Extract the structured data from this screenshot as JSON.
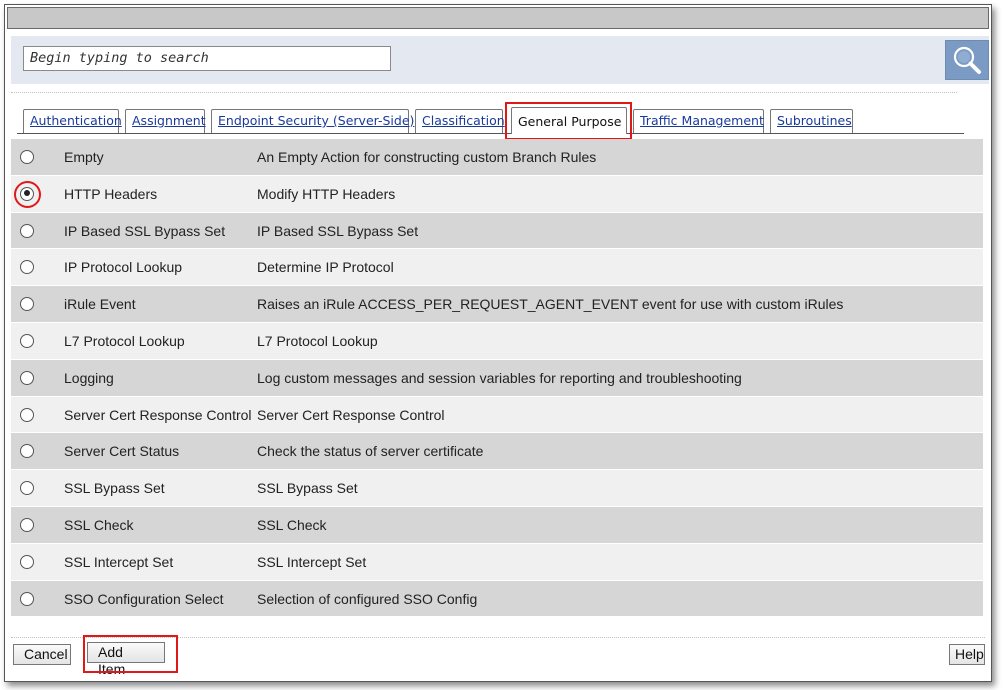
{
  "search": {
    "placeholder": "Begin typing to search"
  },
  "tabs": [
    {
      "label": "Authentication",
      "active": false
    },
    {
      "label": "Assignment",
      "active": false
    },
    {
      "label": "Endpoint Security (Server-Side)",
      "active": false
    },
    {
      "label": "Classification",
      "active": false
    },
    {
      "label": "General Purpose",
      "active": true
    },
    {
      "label": "Traffic Management",
      "active": false
    },
    {
      "label": "Subroutines",
      "active": false
    }
  ],
  "rows": [
    {
      "name": "Empty",
      "desc": "An Empty Action for constructing custom Branch Rules",
      "selected": false
    },
    {
      "name": "HTTP Headers",
      "desc": "Modify HTTP Headers",
      "selected": true
    },
    {
      "name": "IP Based SSL Bypass Set",
      "desc": "IP Based SSL Bypass Set",
      "selected": false
    },
    {
      "name": "IP Protocol Lookup",
      "desc": "Determine IP Protocol",
      "selected": false
    },
    {
      "name": "iRule Event",
      "desc": "Raises an iRule ACCESS_PER_REQUEST_AGENT_EVENT event for use with custom iRules",
      "selected": false
    },
    {
      "name": "L7 Protocol Lookup",
      "desc": "L7 Protocol Lookup",
      "selected": false
    },
    {
      "name": "Logging",
      "desc": "Log custom messages and session variables for reporting and troubleshooting",
      "selected": false
    },
    {
      "name": "Server Cert Response Control",
      "desc": "Server Cert Response Control",
      "selected": false
    },
    {
      "name": "Server Cert Status",
      "desc": "Check the status of server certificate",
      "selected": false
    },
    {
      "name": "SSL Bypass Set",
      "desc": "SSL Bypass Set",
      "selected": false
    },
    {
      "name": "SSL Check",
      "desc": "SSL Check",
      "selected": false
    },
    {
      "name": "SSL Intercept Set",
      "desc": "SSL Intercept Set",
      "selected": false
    },
    {
      "name": "SSO Configuration Select",
      "desc": "Selection of configured SSO Config",
      "selected": false
    }
  ],
  "footer": {
    "cancel_label": "Cancel",
    "add_label": "Add Item",
    "help_label": "Help"
  },
  "colors": {
    "highlight": "#e01818",
    "search_button": "#7b9bc4",
    "tab_link": "#1a3a9a"
  },
  "icons": {
    "search_button": "magnifier-icon"
  }
}
